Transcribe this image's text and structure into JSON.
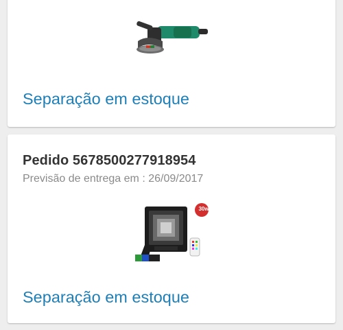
{
  "orders": [
    {
      "product_image": "angle-grinder-image",
      "status_label": "Separação em estoque"
    },
    {
      "title": "Pedido 5678500277918954",
      "delivery_text": "Previsão de entrega em : 26/09/2017",
      "product_image": "led-floodlight-image",
      "badge": "30w",
      "status_label": "Separação em estoque"
    }
  ],
  "colors": {
    "link": "#1e7fb8",
    "title": "#333333",
    "subtitle": "#8a8a8a",
    "background": "#eeeeee",
    "card": "#ffffff"
  }
}
